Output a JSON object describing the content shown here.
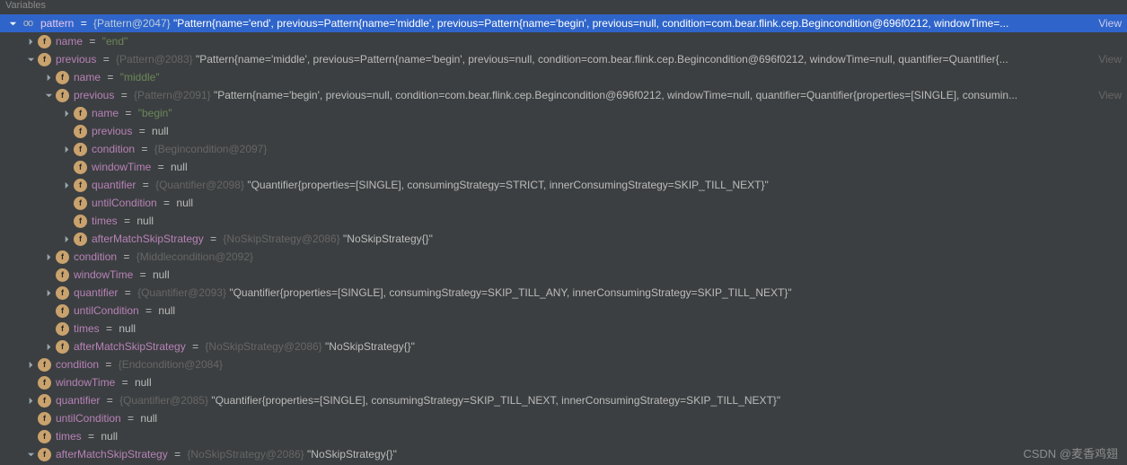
{
  "panel": {
    "title": "Variables"
  },
  "viewLink": "View",
  "rows": [
    {
      "arrow": "down",
      "sel": true,
      "indent": 0,
      "icon": "oo",
      "name": "pattern",
      "obj": "{Pattern@2047}",
      "str": "\"Pattern{name='end', previous=Pattern{name='middle', previous=Pattern{name='begin', previous=null, condition=com.bear.flink.cep.Begincondition@696f0212, windowTime=...",
      "view": true
    },
    {
      "arrow": "right",
      "indent": 1,
      "icon": "f",
      "name": "name",
      "green": "\"end\""
    },
    {
      "arrow": "down",
      "indent": 1,
      "icon": "f",
      "name": "previous",
      "obj": "{Pattern@2083}",
      "str": "\"Pattern{name='middle', previous=Pattern{name='begin', previous=null, condition=com.bear.flink.cep.Begincondition@696f0212, windowTime=null, quantifier=Quantifier{...",
      "view": true
    },
    {
      "arrow": "right",
      "indent": 2,
      "icon": "f",
      "name": "name",
      "green": "\"middle\""
    },
    {
      "arrow": "down",
      "indent": 2,
      "icon": "f",
      "name": "previous",
      "obj": "{Pattern@2091}",
      "str": "\"Pattern{name='begin', previous=null, condition=com.bear.flink.cep.Begincondition@696f0212, windowTime=null, quantifier=Quantifier{properties=[SINGLE], consumin...",
      "view": true
    },
    {
      "arrow": "right",
      "indent": 3,
      "icon": "f",
      "name": "name",
      "green": "\"begin\""
    },
    {
      "arrow": "blank",
      "indent": 3,
      "icon": "f",
      "name": "previous",
      "nullv": "null"
    },
    {
      "arrow": "right",
      "indent": 3,
      "icon": "f",
      "name": "condition",
      "obj": "{Begincondition@2097}"
    },
    {
      "arrow": "blank",
      "indent": 3,
      "icon": "f",
      "name": "windowTime",
      "nullv": "null"
    },
    {
      "arrow": "right",
      "indent": 3,
      "icon": "f",
      "name": "quantifier",
      "obj": "{Quantifier@2098}",
      "str": "\"Quantifier{properties=[SINGLE], consumingStrategy=STRICT, innerConsumingStrategy=SKIP_TILL_NEXT}\""
    },
    {
      "arrow": "blank",
      "indent": 3,
      "icon": "f",
      "name": "untilCondition",
      "nullv": "null"
    },
    {
      "arrow": "blank",
      "indent": 3,
      "icon": "f",
      "name": "times",
      "nullv": "null"
    },
    {
      "arrow": "right",
      "indent": 3,
      "icon": "f",
      "name": "afterMatchSkipStrategy",
      "obj": "{NoSkipStrategy@2086}",
      "str": "\"NoSkipStrategy{}\""
    },
    {
      "arrow": "right",
      "indent": 2,
      "icon": "f",
      "name": "condition",
      "obj": "{Middlecondition@2092}"
    },
    {
      "arrow": "blank",
      "indent": 2,
      "icon": "f",
      "name": "windowTime",
      "nullv": "null"
    },
    {
      "arrow": "right",
      "indent": 2,
      "icon": "f",
      "name": "quantifier",
      "obj": "{Quantifier@2093}",
      "str": "\"Quantifier{properties=[SINGLE], consumingStrategy=SKIP_TILL_ANY, innerConsumingStrategy=SKIP_TILL_NEXT}\""
    },
    {
      "arrow": "blank",
      "indent": 2,
      "icon": "f",
      "name": "untilCondition",
      "nullv": "null"
    },
    {
      "arrow": "blank",
      "indent": 2,
      "icon": "f",
      "name": "times",
      "nullv": "null"
    },
    {
      "arrow": "right",
      "indent": 2,
      "icon": "f",
      "name": "afterMatchSkipStrategy",
      "obj": "{NoSkipStrategy@2086}",
      "str": "\"NoSkipStrategy{}\""
    },
    {
      "arrow": "right",
      "indent": 1,
      "icon": "f",
      "name": "condition",
      "obj": "{Endcondition@2084}"
    },
    {
      "arrow": "blank",
      "indent": 1,
      "icon": "f",
      "name": "windowTime",
      "nullv": "null"
    },
    {
      "arrow": "right",
      "indent": 1,
      "icon": "f",
      "name": "quantifier",
      "obj": "{Quantifier@2085}",
      "str": "\"Quantifier{properties=[SINGLE], consumingStrategy=SKIP_TILL_NEXT, innerConsumingStrategy=SKIP_TILL_NEXT}\""
    },
    {
      "arrow": "blank",
      "indent": 1,
      "icon": "f",
      "name": "untilCondition",
      "nullv": "null"
    },
    {
      "arrow": "blank",
      "indent": 1,
      "icon": "f",
      "name": "times",
      "nullv": "null"
    },
    {
      "arrow": "down",
      "indent": 1,
      "icon": "f",
      "name": "afterMatchSkipStrategy",
      "obj": "{NoSkipStrategy@2086}",
      "str": "\"NoSkipStrategy{}\""
    }
  ],
  "watermark": "CSDN @麦香鸡翅"
}
